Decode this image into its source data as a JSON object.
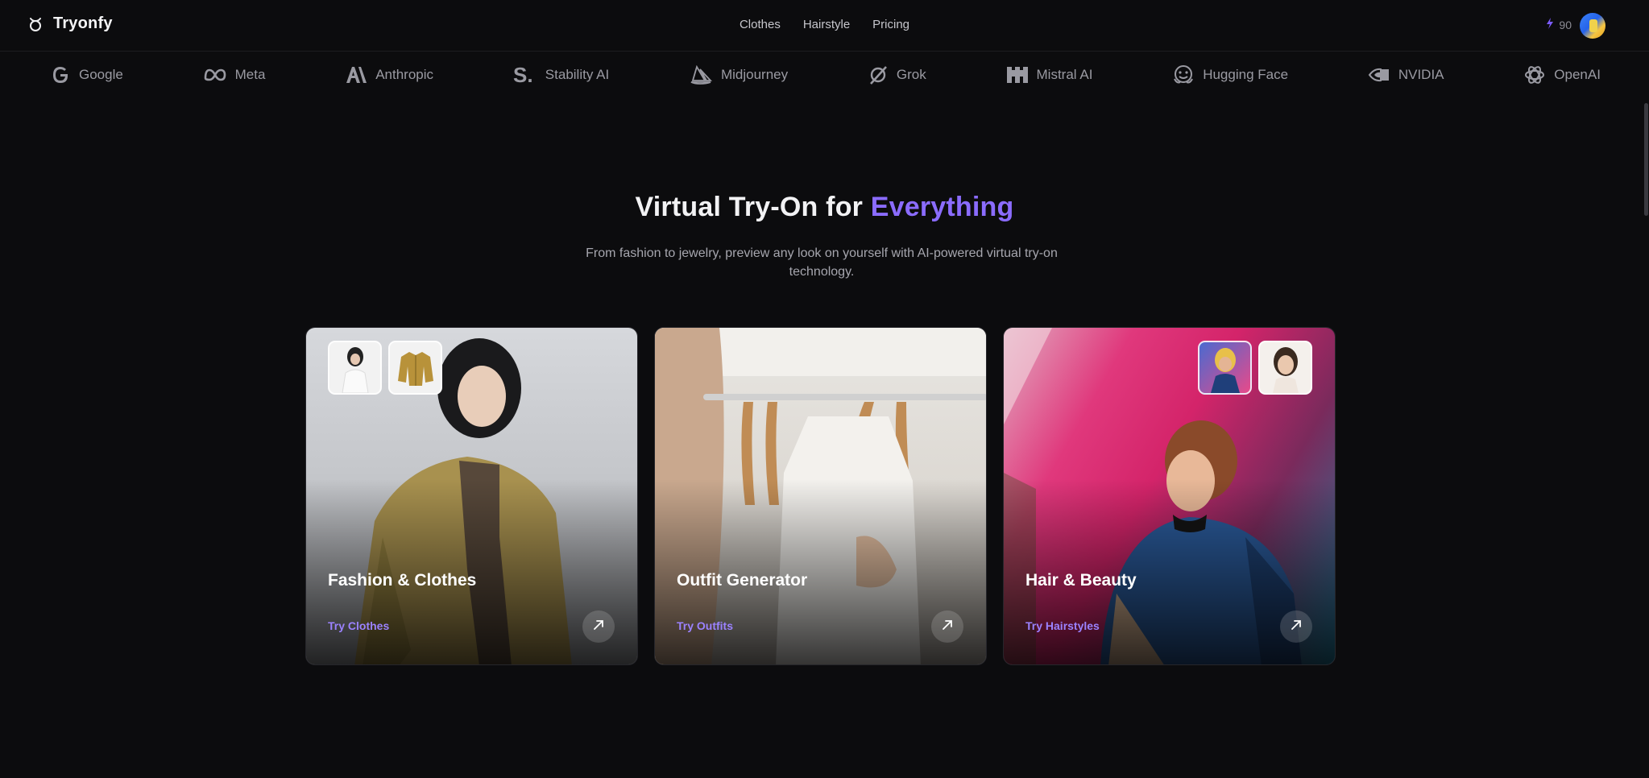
{
  "header": {
    "brand": "Tryonfy",
    "nav": [
      {
        "label": "Clothes"
      },
      {
        "label": "Hairstyle"
      },
      {
        "label": "Pricing"
      }
    ],
    "credits": "90",
    "credits_icon": "lightning-icon",
    "avatar": "user-avatar"
  },
  "partners": [
    {
      "label": "Google",
      "icon": "google-icon"
    },
    {
      "label": "Meta",
      "icon": "meta-icon"
    },
    {
      "label": "Anthropic",
      "icon": "anthropic-icon"
    },
    {
      "label": "Stability AI",
      "icon": "stability-ai-icon"
    },
    {
      "label": "Midjourney",
      "icon": "midjourney-icon"
    },
    {
      "label": "Grok",
      "icon": "grok-icon"
    },
    {
      "label": "Mistral AI",
      "icon": "mistral-icon"
    },
    {
      "label": "Hugging Face",
      "icon": "hugging-face-icon"
    },
    {
      "label": "NVIDIA",
      "icon": "nvidia-icon"
    },
    {
      "label": "OpenAI",
      "icon": "openai-icon"
    }
  ],
  "hero": {
    "title_main": "Virtual Try-On for ",
    "title_accent": "Everything",
    "subtitle": "From fashion to jewelry, preview any look on yourself with AI-powered virtual try-on technology."
  },
  "cards": [
    {
      "title": "Fashion & Clothes",
      "link": "Try Clothes"
    },
    {
      "title": "Outfit Generator",
      "link": "Try Outfits"
    },
    {
      "title": "Hair & Beauty",
      "link": "Try Hairstyles"
    }
  ],
  "colors": {
    "background": "#0c0c0e",
    "accent": "#8b6cff",
    "link": "#9b82ff",
    "muted_text": "#a6a6ae"
  }
}
